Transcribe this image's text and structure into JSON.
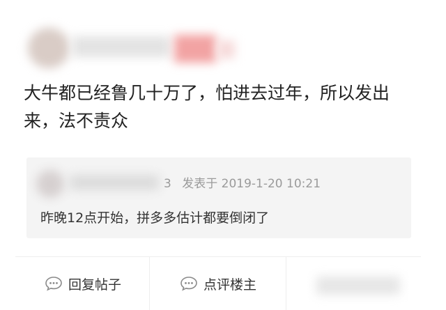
{
  "post": {
    "text": "大牛都已经鲁几十万了，怕进去过年，所以发出来，法不责众"
  },
  "quote": {
    "author_suffix": "3",
    "posted_label": "发表于",
    "datetime": "2019-1-20 10:21",
    "text": "昨晚12点开始，拼多多估计都要倒闭了"
  },
  "actions": {
    "reply_label": "回复帖子",
    "comment_label": "点评楼主"
  },
  "colors": {
    "text": "#222222",
    "meta": "#9a9a9a",
    "quote_bg": "#f4f4f4",
    "divider": "#eeeeee"
  }
}
